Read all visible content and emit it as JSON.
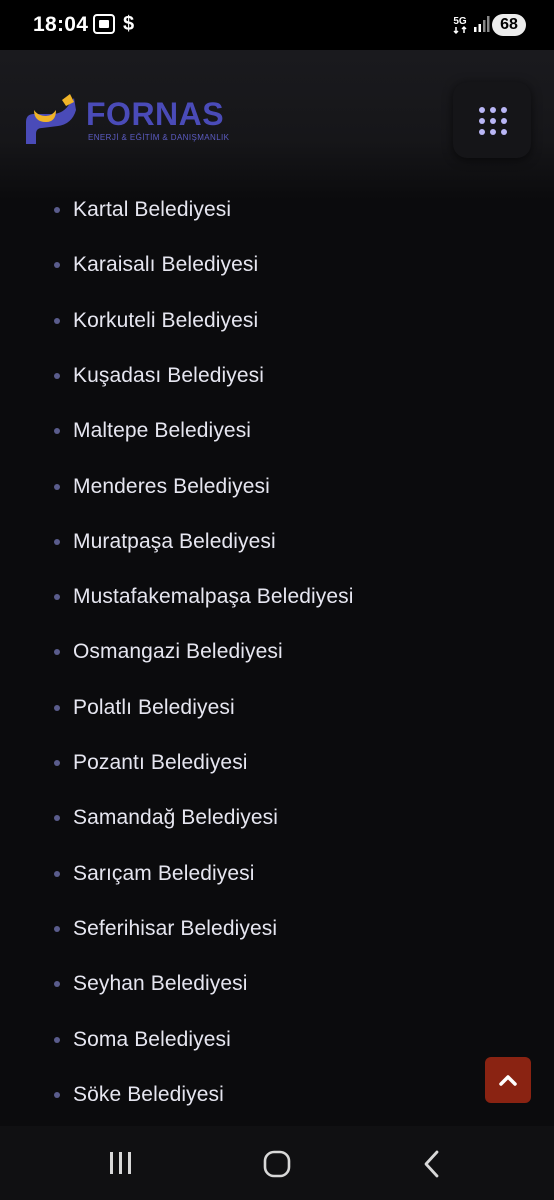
{
  "status_bar": {
    "time": "18:04",
    "dollar_glyph": "$",
    "network_label": "5G",
    "battery": "68",
    "icons": [
      "screen-cast-icon",
      "dollar-icon",
      "5g-icon",
      "signal-icon",
      "battery-icon"
    ]
  },
  "header": {
    "logo_name": "FORNAS",
    "logo_subtitle": "ENERJİ & EĞİTİM & DANIŞMANLIK",
    "menu_icon": "grid-menu-icon",
    "brand_colors": {
      "primary": "#4a4bb8",
      "accent": "#f0b428"
    }
  },
  "list": {
    "items": [
      "Kartal Belediyesi",
      "Karaisalı Belediyesi",
      "Korkuteli Belediyesi",
      "Kuşadası Belediyesi",
      "Maltepe Belediyesi",
      "Menderes Belediyesi",
      "Muratpaşa Belediyesi",
      "Mustafakemalpaşa Belediyesi",
      "Osmangazi Belediyesi",
      "Polatlı Belediyesi",
      "Pozantı Belediyesi",
      "Samandağ Belediyesi",
      "Sarıçam Belediyesi",
      "Seferihisar Belediyesi",
      "Seyhan Belediyesi",
      "Soma Belediyesi",
      "Söke Belediyesi"
    ]
  },
  "back_to_top": {
    "icon": "chevron-up-icon",
    "color": "#8a2312"
  },
  "nav_bar": {
    "icons": [
      "recents-icon",
      "home-icon",
      "back-icon"
    ]
  }
}
